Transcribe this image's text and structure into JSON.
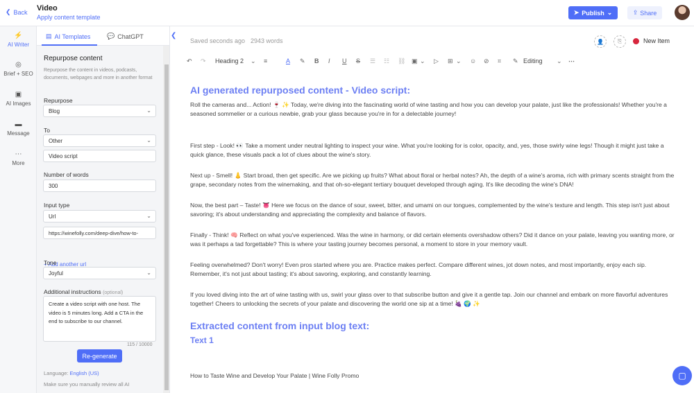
{
  "header": {
    "back_label": "Back",
    "doc_title": "Video",
    "apply_template": "Apply content template",
    "publish_label": "Publish",
    "share_label": "Share"
  },
  "rail": {
    "items": [
      {
        "label": "AI Writer",
        "icon": "lightning-icon"
      },
      {
        "label": "Brief + SEO",
        "icon": "target-icon"
      },
      {
        "label": "AI Images",
        "icon": "image-icon"
      },
      {
        "label": "Message",
        "icon": "message-icon"
      },
      {
        "label": "More",
        "icon": "more-icon"
      }
    ]
  },
  "panel": {
    "tab_templates": "AI Templates",
    "tab_chatgpt": "ChatGPT",
    "section_title": "Repurpose content",
    "section_help": "Repurpose the content in videos, podcasts, documents, webpages and more in another format",
    "repurpose_label": "Repurpose",
    "repurpose_value": "Blog",
    "to_label": "To",
    "to_value": "Other",
    "to_other_value": "Video script",
    "words_label": "Number of words",
    "words_value": "300",
    "input_type_label": "Input type",
    "input_type_value": "Url",
    "url_value": "https://winefolly.com/deep-dive/how-to-",
    "add_url": "Add another url",
    "tone_label": "Tone",
    "tone_value": "Joyful",
    "instructions_label": "Additional instructions",
    "instructions_optional": "(optional)",
    "instructions_value": "Create a video script with one host. The video is 5 minutes long. Add a CTA in the end to subscribe to our channel.",
    "counter": "115 / 10000",
    "regenerate": "Re-generate",
    "language_prefix": "Language:",
    "language_value": "English (US)",
    "disclaimer": "Make sure you manually review all AI"
  },
  "editor": {
    "saved": "Saved seconds ago",
    "words": "2943 words",
    "new_item": "New Item",
    "heading_select": "Heading 2",
    "editing_mode": "Editing",
    "h_title": "AI generated repurposed content - Video script:",
    "p1": "Roll the cameras and... Action! 🍷 ✨ Today, we're diving into the fascinating world of wine tasting and how you can develop your palate, just like the professionals! Whether you're a seasoned sommelier or a curious newbie, grab your glass because you're in for a delectable journey!",
    "p2": "First step - Look! 👀 Take a moment under neutral lighting to inspect your wine. What you're looking for is color, opacity, and, yes, those swirly wine legs! Though it might just take a quick glance, these visuals pack a lot of clues about the wine's story.",
    "p3": "Next up - Smell! 👃 Start broad, then get specific. Are we picking up fruits? What about floral or herbal notes? Ah, the depth of a wine's aroma, rich with primary scents straight from the grape, secondary notes from the winemaking, and that oh-so-elegant tertiary bouquet developed through aging. It's like decoding the wine's DNA!",
    "p4": "Now, the best part – Taste! 👅 Here we focus on the dance of sour, sweet, bitter, and umami on our tongues, complemented by the wine's texture and length. This step isn't just about savoring; it's about understanding and appreciating the complexity and balance of flavors.",
    "p5": "Finally - Think! 🧠 Reflect on what you've experienced. Was the wine in harmony, or did certain elements overshadow others? Did it dance on your palate, leaving you wanting more, or was it perhaps a tad forgettable? This is where your tasting journey becomes personal, a moment to store in your memory vault.",
    "p6": "Feeling overwhelmed? Don't worry! Even pros started where you are. Practice makes perfect. Compare different wines, jot down notes, and most importantly, enjoy each sip. Remember, it's not just about tasting; it's about savoring, exploring, and constantly learning.",
    "p7": "If you loved diving into the art of wine tasting with us, swirl your glass over to that subscribe button and give it a gentle tap. Join our channel and embark on more flavorful adventures together! Cheers to unlocking the secrets of your palate and discovering the world one sip at a time! 🍇 🌍 ✨",
    "h_extracted": "Extracted content from input  blog text:",
    "h_text1": "Text 1",
    "p_source": "How to Taste Wine and Develop Your Palate | Wine Folly  Promo"
  },
  "colors": {
    "accent": "#4f6ef7",
    "heading": "#6c7ff3",
    "new_item_dot": "#d7263d"
  }
}
